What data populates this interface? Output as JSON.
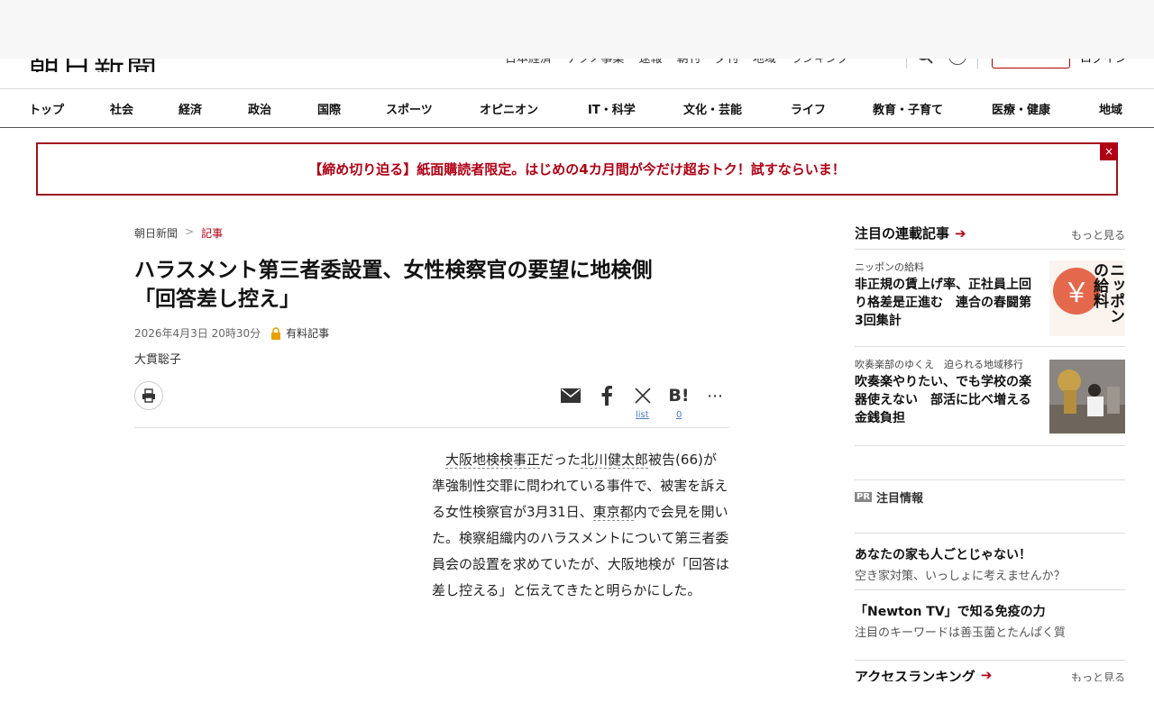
{
  "header": {
    "logo": "朝日新聞",
    "links": "日本経済 テクノ事業 速報 朝刊 夕刊 地域 ランキング",
    "subscribe_label": "",
    "login_label": "ログイン"
  },
  "nav": {
    "items": [
      "トップ",
      "社会",
      "経済",
      "政治",
      "国際",
      "スポーツ",
      "オピニオン",
      "IT・科学",
      "文化・芸能",
      "ライフ",
      "教育・子育て",
      "医療・健康",
      "地域"
    ]
  },
  "promo": {
    "text": "【締め切り迫る】紙面購読者限定。はじめの4カ月間が今だけ超おトク！試すならいま！",
    "close": "×"
  },
  "breadcrumb": {
    "home": "朝日新聞",
    "sep": ">",
    "current": "記事"
  },
  "article": {
    "headline_line1": "ハラスメント第三者委設置、女性検察官の要望に地検側",
    "headline_line2": "「回答差し控え」",
    "date": "2026年4月3日 20時30分",
    "paid_label": "有料記事",
    "author": "大貫聡子",
    "body": {
      "kw1": "大阪地検検事正",
      "t1": "だった",
      "kw2": "北川健太郎",
      "t2": "被告(66)が準強制性交罪に問われている事件で、被害を訴える女性検察官が3月31日、",
      "kw3": "東京都",
      "t3": "内で会見を開いた。検察組織内のハラスメントについて第三者委員会の設置を求めていたが、大阪地検が「回答は差し控える」と伝えてきたと明らかにした。"
    }
  },
  "share": {
    "x_count": "list",
    "hatena_count": "0"
  },
  "sidebar": {
    "series_head": "注目の連載記事",
    "more1": "もっと見る",
    "cards": [
      {
        "series": "ニッポンの給料",
        "title": "非正規の賃上げ率、正社員上回り格差是正進む　連合の春闘第3回集計"
      },
      {
        "series": "吹奏楽部のゆくえ　迫られる地域移行",
        "title": "吹奏楽やりたい、でも学校の楽器使えない　部活に比べ増える金銭負担"
      }
    ],
    "pr_badge": "PR",
    "pr_head": "注目情報",
    "pr_items": [
      {
        "title": "あなたの家も人ごとじゃない！",
        "sub": "空き家対策、いっしょに考えませんか？"
      },
      {
        "title": "「Newton TV」で知る免疫の力",
        "sub": "注目のキーワードは善玉菌とたんぱく質"
      }
    ],
    "ranking_head": "アクセスランキング",
    "more2": "もっと見る",
    "thumb1_text": "ニッポンの給料"
  },
  "colors": {
    "accent": "#b00014",
    "link": "#4a7bbf"
  }
}
